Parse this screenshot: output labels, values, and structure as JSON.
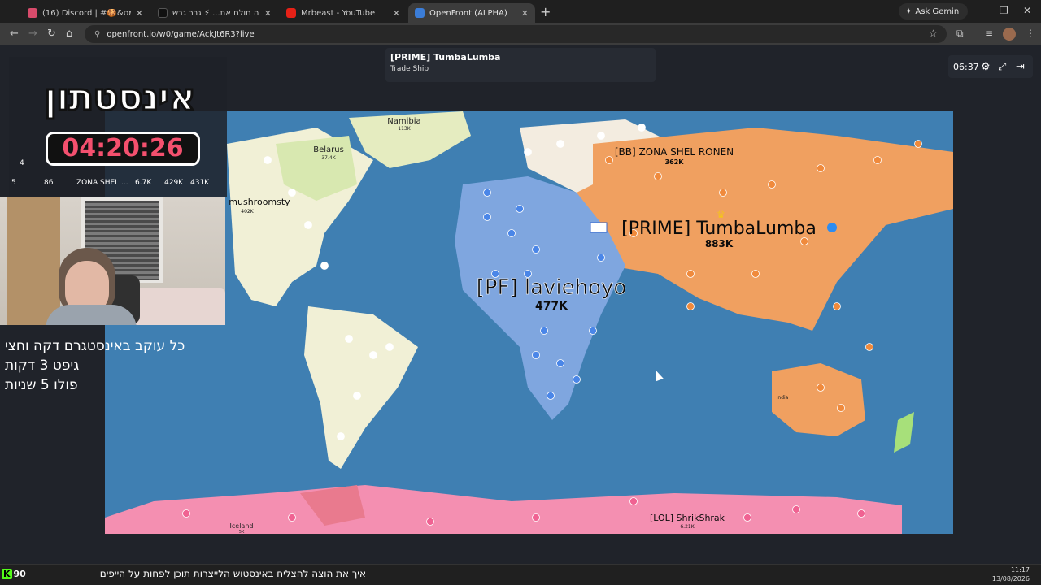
{
  "browser": {
    "tabs": [
      {
        "label": "(16) Discord | #🍪&מימס",
        "color": "#d84b6b"
      },
      {
        "label": "כשאתה חולם את... ⚡ גבר גבש",
        "color": "#111111"
      },
      {
        "label": "Mrbeast - YouTube",
        "color": "#e62117"
      },
      {
        "label": "OpenFront (ALPHA)",
        "color": "#3b7dd8"
      }
    ],
    "new_tab": "+",
    "gemini_label": "Ask Gemini",
    "url": "openfront.io/w0/game/AckJt6R3?live"
  },
  "game": {
    "tooltip": {
      "title": "[PRIME] TumbaLumba",
      "subtitle": "Trade Ship"
    },
    "timer": "06:37",
    "players": [
      {
        "name": "[PF] laviehoyo",
        "troops": "477K"
      },
      {
        "name": "[PRIME] TumbaLumba",
        "troops": "883K"
      },
      {
        "name": "[BB] ZONA SHEL RONEN",
        "troops": "362K"
      },
      {
        "name": "mushroomsty",
        "troops": "402K"
      },
      {
        "name": "[LOL] ShrikShrak",
        "troops": "6.21K"
      },
      {
        "name": "Namibia",
        "troops": "113K"
      },
      {
        "name": "Belarus",
        "troops": "37.4K"
      },
      {
        "name": "Iceland",
        "troops": "5K"
      },
      {
        "name": "India",
        "troops": ""
      }
    ],
    "leaderboard": {
      "rank4": "4",
      "row": {
        "rank": "5",
        "tiles": "86",
        "name": "ZONA SHEL ...",
        "gold": "6.7K",
        "troops": "429K",
        "max": "431K"
      }
    }
  },
  "overlay": {
    "title": "אינסטתון",
    "timer": "04:20:26",
    "lines": [
      "כל עוקב באינסטגרם דקה וחצי",
      "גיפט 3 דקות",
      "פולו 5 שניות"
    ],
    "ticker": "איך את הוצה להצליח באינסטוש הלייצרות תוכן לפחות על הייפים"
  },
  "taskbar": {
    "badge": "90",
    "time": "11:17",
    "date": "13/08/2026"
  },
  "colors": {
    "ocean": "#3f7fb2",
    "prime": "#f0a060",
    "pf": "#7fa6df",
    "bb": "#f3ece0",
    "mushroom": "#f1f0d6",
    "lol": "#f48fb1"
  }
}
